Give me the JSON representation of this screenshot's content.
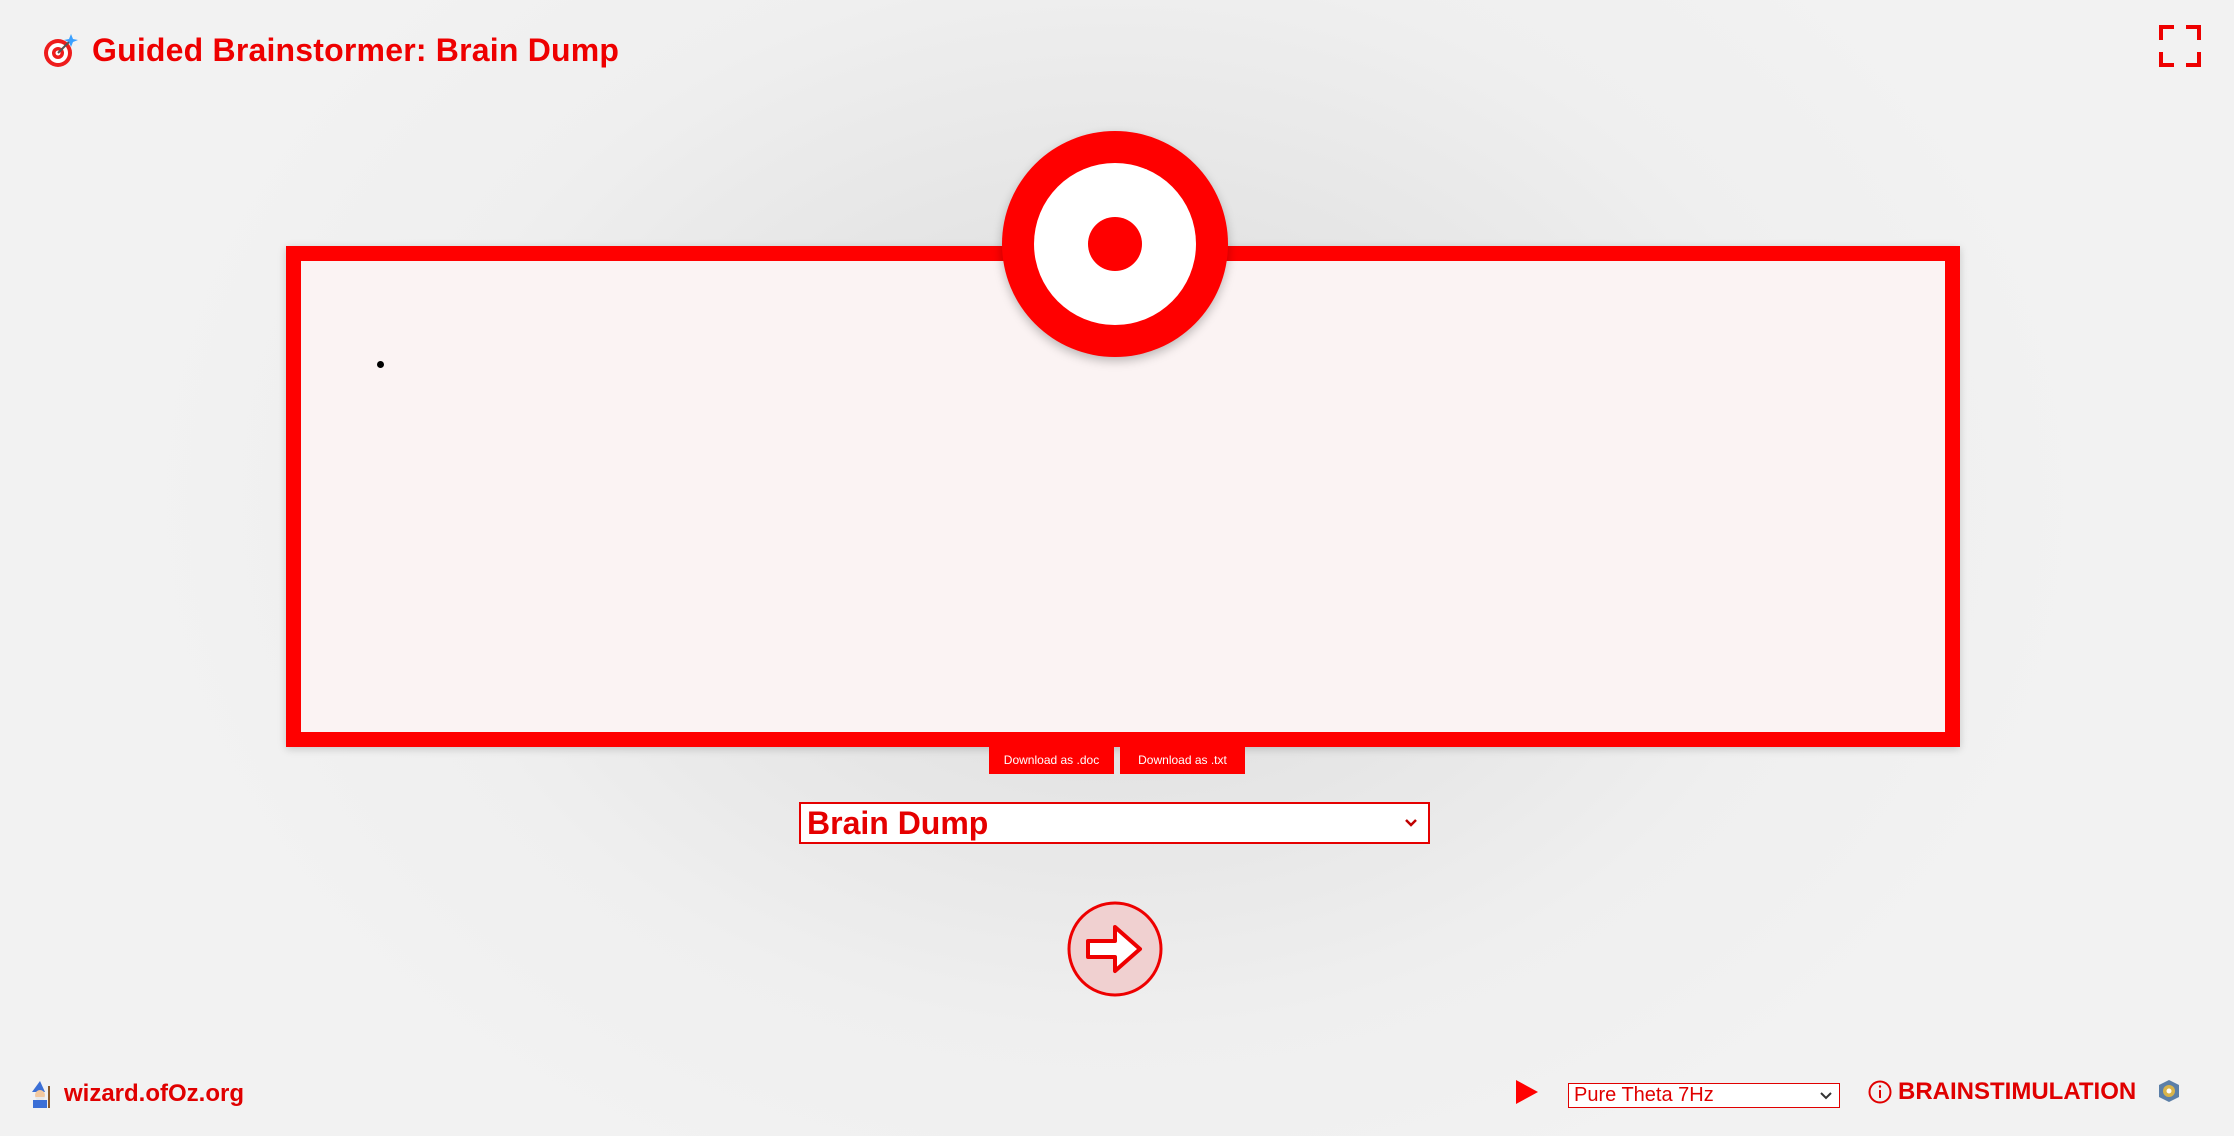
{
  "header": {
    "title": "Guided Brainstormer: Brain Dump",
    "app_icon": "target-sparkle-icon",
    "fullscreen_icon": "fullscreen-icon"
  },
  "editor": {
    "items": [
      ""
    ],
    "logo_icon": "target-icon"
  },
  "downloads": {
    "doc_label": "Download as .doc",
    "txt_label": "Download as .txt"
  },
  "mode_select": {
    "selected": "Brain Dump"
  },
  "next_button": {
    "icon": "arrow-right-circle-icon"
  },
  "footer": {
    "site_link": "wizard.ofOz.org",
    "site_icon": "wizard-icon",
    "play_icon": "play-icon",
    "tone_select": {
      "selected": "Pure Theta 7Hz"
    },
    "brainstim_label": "BRAINSTIMULATION",
    "brainstim_icon": "info-icon",
    "corner_icon": "brain-logo-icon"
  },
  "colors": {
    "accent": "#ff0000",
    "editor_bg": "#fbf3f3",
    "page_bg": "#f2f2f2",
    "text_on_accent": "#ffffff"
  }
}
